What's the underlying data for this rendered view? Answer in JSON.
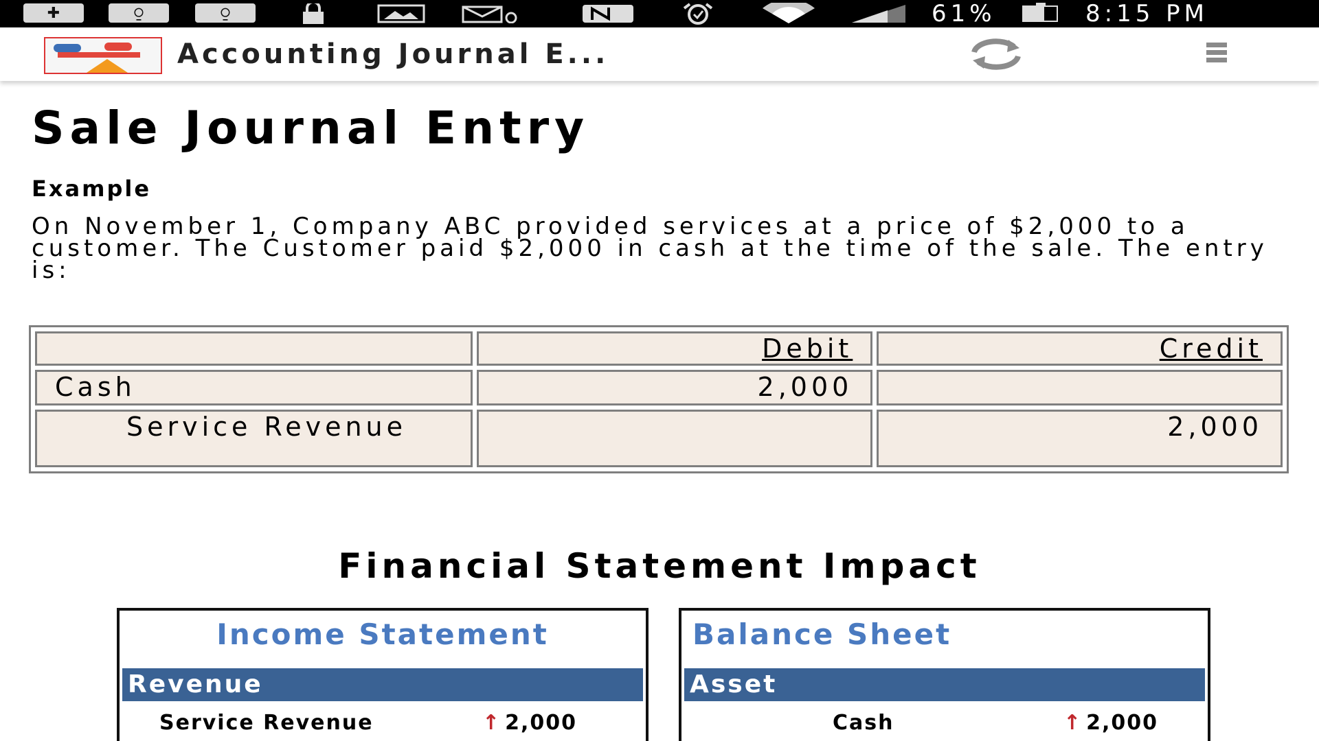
{
  "status_bar": {
    "battery": "61%",
    "time": "8:15 PM",
    "icons": [
      "add-icon",
      "chat-icon",
      "chat-icon",
      "lock-icon",
      "image-icon",
      "mail-icon",
      "nfc-icon",
      "alarm-icon",
      "wifi-icon",
      "signal-icon",
      "battery-icon"
    ]
  },
  "app_bar": {
    "title": "Accounting Journal E...",
    "refresh_icon": "refresh-icon",
    "menu_icon": "menu-icon"
  },
  "page": {
    "title": "Sale Journal Entry",
    "example_label": "Example",
    "example_text": "On November 1, Company ABC provided services at a price of $2,000 to a customer. The Customer paid $2,000 in cash at the time of the sale. The entry is:"
  },
  "journal_table": {
    "headers": [
      "",
      "Debit",
      "Credit"
    ],
    "rows": [
      {
        "account": "Cash",
        "debit": "2,000",
        "credit": ""
      },
      {
        "account": "Service Revenue",
        "debit": "",
        "credit": "2,000"
      }
    ]
  },
  "impact": {
    "title": "Financial Statement Impact",
    "income_statement": {
      "title": "Income Statement",
      "section": "Revenue",
      "item": "Service Revenue",
      "value": "2,000",
      "direction": "up"
    },
    "balance_sheet": {
      "title": "Balance Sheet",
      "section": "Asset",
      "item": "Cash",
      "value": "2,000",
      "direction": "up"
    }
  },
  "colors": {
    "accent_blue": "#4a7ac0",
    "header_band": "#3a6294",
    "table_cell": "#f4ece4",
    "arrow_red": "#c0282d"
  }
}
